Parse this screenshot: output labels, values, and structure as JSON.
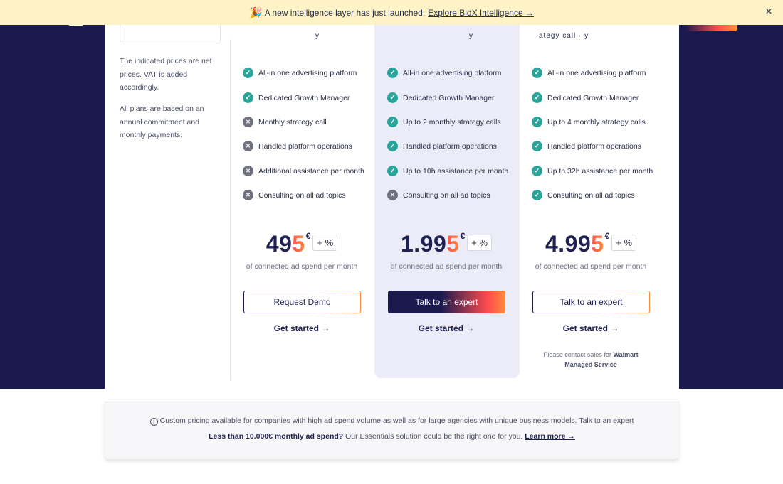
{
  "banner": {
    "emoji": "🎉",
    "text": "A new intelligence layer has just launched:",
    "link": "Explore BidX Intelligence →",
    "close_icon": "×"
  },
  "sidebar": {
    "note_1": "The indicated prices are net prices. VAT is added accordingly.",
    "note_2": "All plans are based on an annual commitment and monthly payments."
  },
  "plans": [
    {
      "features": [
        {
          "icon": "check",
          "label": "All-in one advertising platform"
        },
        {
          "icon": "cross",
          "label": "Dedicated Growth Manager"
        },
        {
          "icon": "cross",
          "label": "Monthly strategy call"
        },
        {
          "icon": "cross",
          "label": "Handled platform operations"
        },
        {
          "icon": "cross",
          "label": "Additional assistance per month"
        },
        {
          "icon": "cross",
          "label": "Consulting on all ad topics"
        }
      ],
      "price_main": "49",
      "price_tail": "5",
      "currency": "€",
      "percent": "+ %",
      "price_sub": "of connected ad spend per month",
      "button": "Request Demo",
      "get_started": "Get started →"
    },
    {
      "features": [
        {
          "icon": "check",
          "label": "All-in one advertising platform"
        },
        {
          "icon": "check",
          "label": "Dedicated Growth Manager"
        },
        {
          "icon": "check",
          "label": "Up to 2 monthly strategy calls"
        },
        {
          "icon": "check",
          "label": "Handled platform operations"
        },
        {
          "icon": "check",
          "label": "Up to 10h assistance per month"
        },
        {
          "icon": "cross",
          "label": "Consulting on all ad topics"
        }
      ],
      "price_main": "1.99",
      "price_tail": "5",
      "currency": "€",
      "percent": "+ %",
      "price_sub": "of connected ad spend per month",
      "button": "Talk to an expert",
      "get_started": "Get started →"
    },
    {
      "features": [
        {
          "icon": "check",
          "label": "All-in one advertising platform"
        },
        {
          "icon": "check",
          "label": "Dedicated Growth Manager"
        },
        {
          "icon": "check",
          "label": "Up to 4 monthly strategy calls"
        },
        {
          "icon": "check",
          "label": "Handled platform operations"
        },
        {
          "icon": "check",
          "label": "Up to 32h assistance per month"
        },
        {
          "icon": "check",
          "label": "Consulting on all ad topics"
        }
      ],
      "price_main": "4.99",
      "price_tail": "5",
      "currency": "€",
      "percent": "+ %",
      "price_sub": "of connected ad spend per month",
      "button": "Talk to an expert",
      "get_started": "Get started →",
      "contact_prefix": "Please contact sales for",
      "contact_bold": "Walmart Managed Service"
    }
  ],
  "footer": {
    "line1": "Custom pricing available for companies with high ad spend volume as well as for large agencies with unique business models. Talk to an expert",
    "line2_bold": "Less than 10.000€ monthly ad spend?",
    "line2_text": "Our Essentials solution could be the right one for you.",
    "line2_link": "Learn more →"
  },
  "colors": {
    "navy": "#1a1a4e",
    "accent_orange": "#ff8c3a",
    "accent_red": "#ff4d4d",
    "check_teal": "#2ba59a",
    "cross_gray": "#6f717f",
    "banner_yellow": "#fdf3c7",
    "highlight": "#ececf9"
  }
}
